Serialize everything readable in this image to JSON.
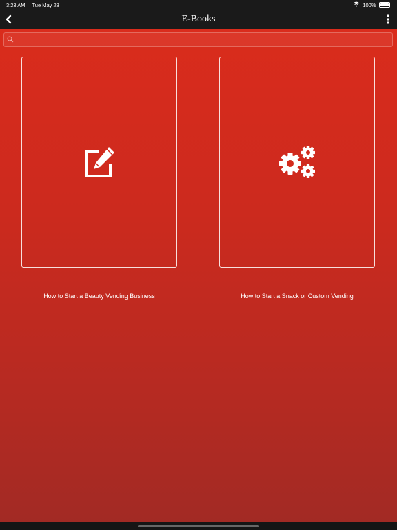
{
  "status_bar": {
    "time": "3:23 AM",
    "date": "Tue May 23",
    "battery": "100%"
  },
  "nav": {
    "title": "E-Books",
    "back_icon": "chevron-left-icon",
    "more_icon": "more-vertical-icon"
  },
  "search": {
    "placeholder": "",
    "value": ""
  },
  "books": [
    {
      "label": "How to Start a Beauty Vending Business",
      "icon": "edit-icon"
    },
    {
      "label": "How to Start a Snack or Custom Vending",
      "icon": "gears-icon"
    }
  ],
  "colors": {
    "background_top": "#dc2c1c",
    "background_bottom": "#a12a24",
    "bar": "#1a1a1a"
  }
}
